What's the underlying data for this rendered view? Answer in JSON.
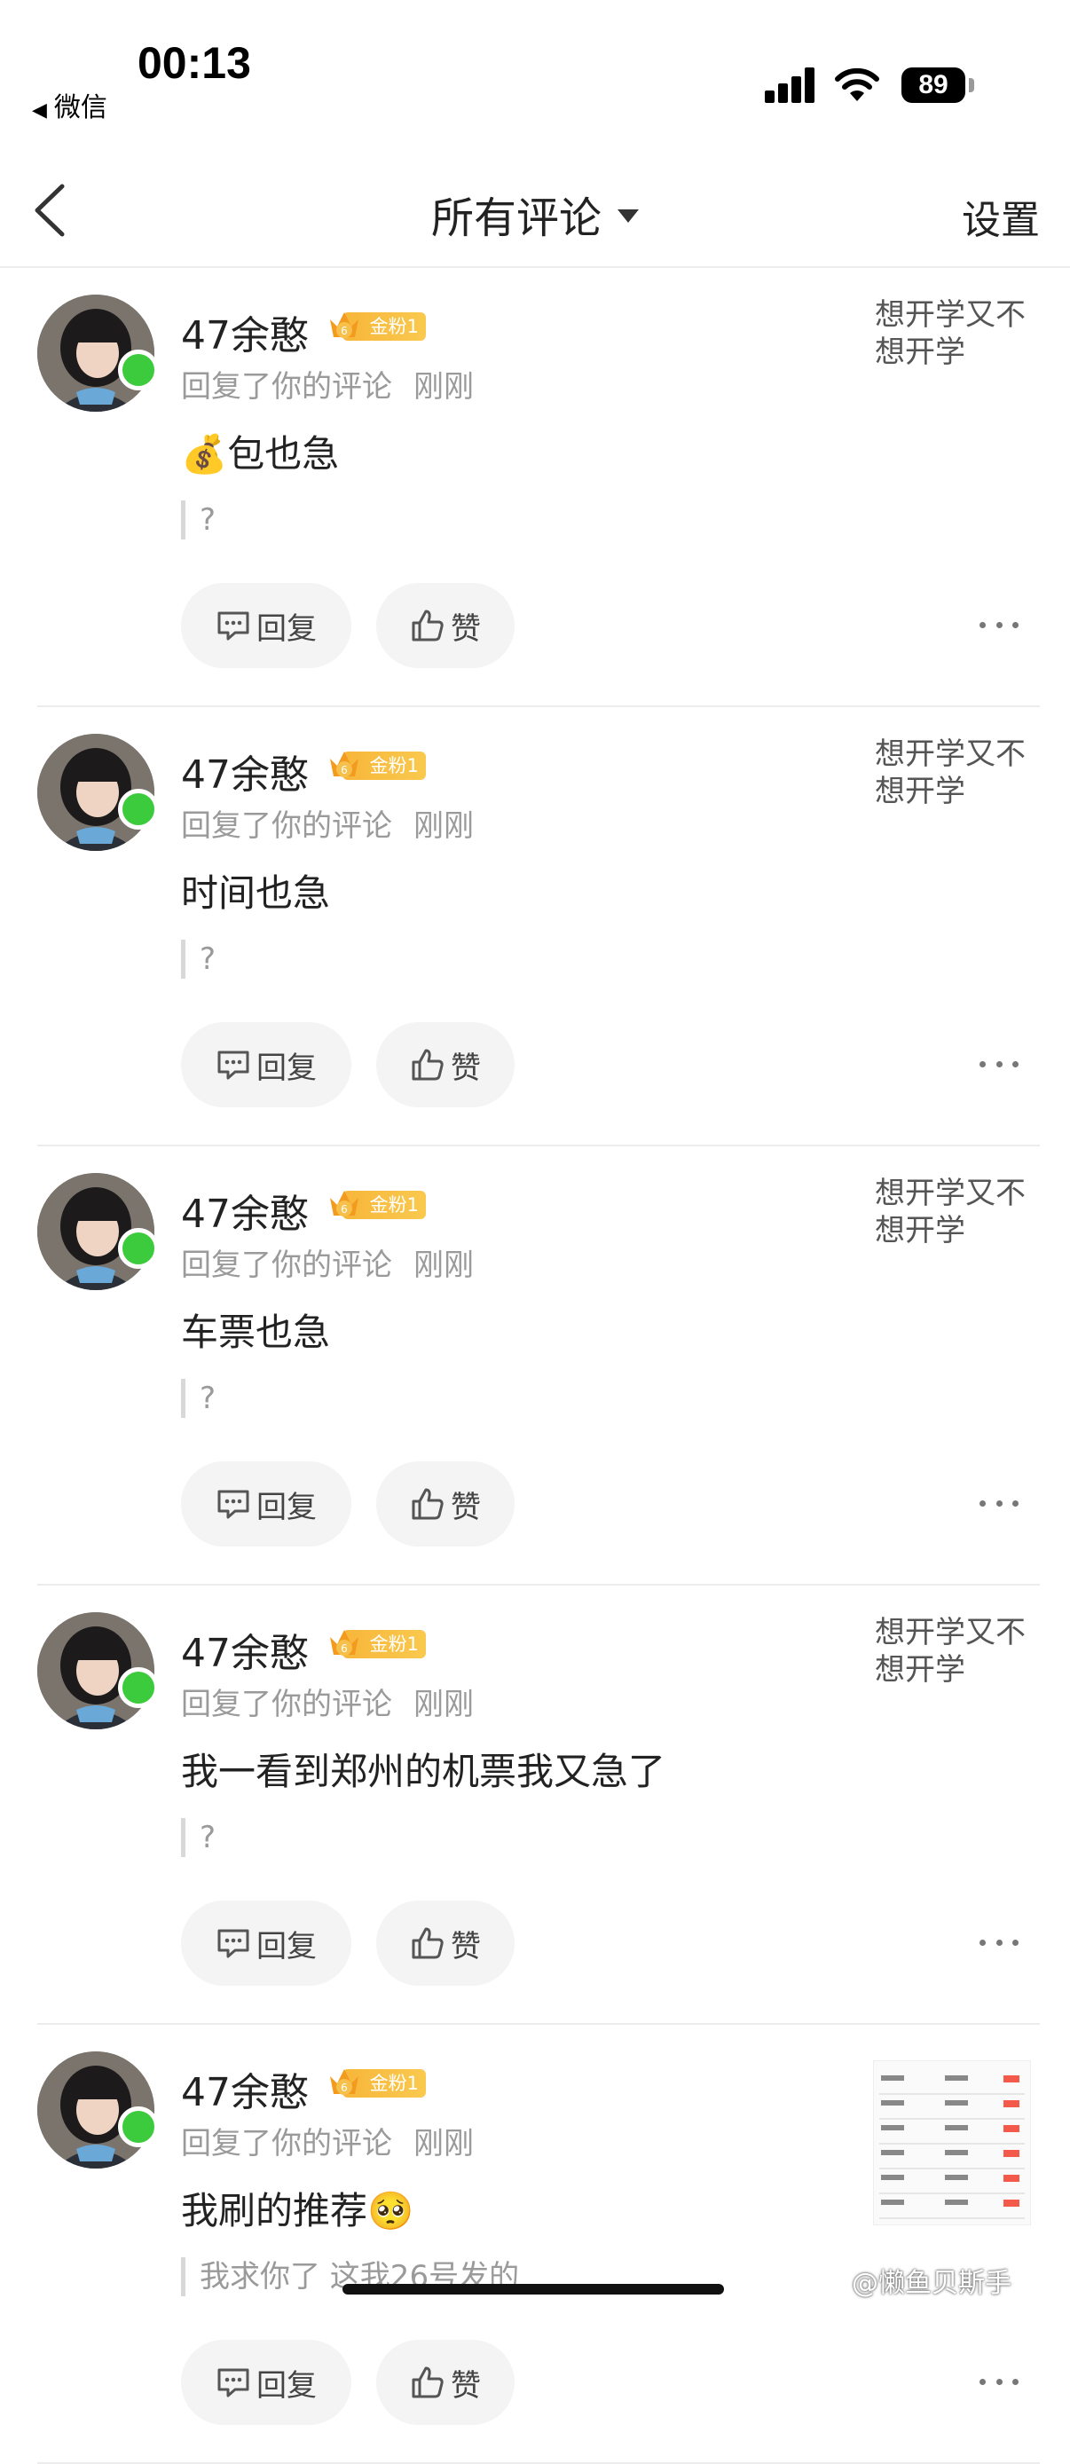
{
  "status_bar": {
    "time": "00:13",
    "back_app": "微信",
    "battery": "89"
  },
  "header": {
    "title": "所有评论",
    "settings": "设置"
  },
  "comments": [
    {
      "user": "47余憨",
      "badge": "金粉1",
      "action": "回复了你的评论",
      "time": "刚刚",
      "origin": "想开学又不想开学",
      "prefix_emoji": "💰",
      "content": "包也急",
      "quote": "?",
      "reply": "回复",
      "like": "赞"
    },
    {
      "user": "47余憨",
      "badge": "金粉1",
      "action": "回复了你的评论",
      "time": "刚刚",
      "origin": "想开学又不想开学",
      "prefix_emoji": "",
      "content": "时间也急",
      "quote": "?",
      "reply": "回复",
      "like": "赞"
    },
    {
      "user": "47余憨",
      "badge": "金粉1",
      "action": "回复了你的评论",
      "time": "刚刚",
      "origin": "想开学又不想开学",
      "prefix_emoji": "",
      "content": "车票也急",
      "quote": "?",
      "reply": "回复",
      "like": "赞"
    },
    {
      "user": "47余憨",
      "badge": "金粉1",
      "action": "回复了你的评论",
      "time": "刚刚",
      "origin": "想开学又不想开学",
      "prefix_emoji": "",
      "content": "我一看到郑州的机票我又急了",
      "quote": "?",
      "reply": "回复",
      "like": "赞"
    },
    {
      "user": "47余憨",
      "badge": "金粉1",
      "action": "回复了你的评论",
      "time": "刚刚",
      "origin": "",
      "prefix_emoji": "",
      "content": "我刷的推荐🥺",
      "quote": "我求你了 这我26号发的",
      "reply": "回复",
      "like": "赞"
    }
  ],
  "watermark": "@懒鱼贝斯手",
  "colors": {
    "online": "#3ccb3c",
    "badge": "#f7b63a",
    "divider": "#ececec",
    "button_bg": "#f4f4f4"
  },
  "icons": {
    "back": "chevron-left-icon",
    "dropdown": "caret-down-icon",
    "reply": "comment-icon",
    "like": "thumbs-up-icon",
    "more": "ellipsis-icon"
  }
}
